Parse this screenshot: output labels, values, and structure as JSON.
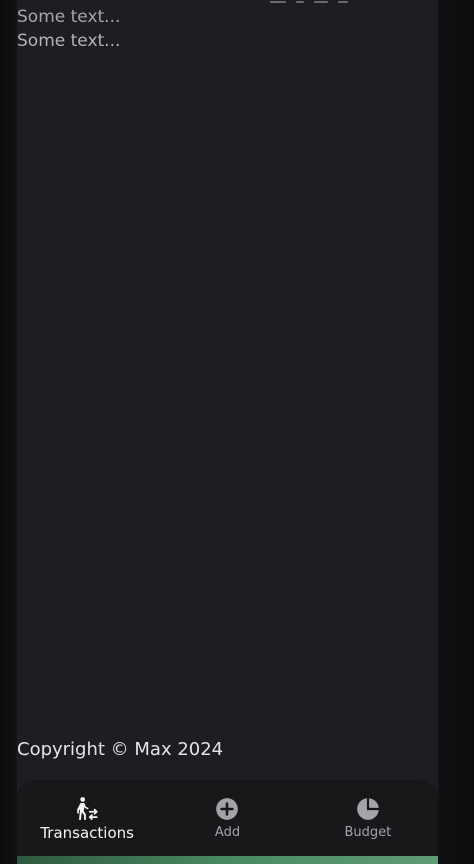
{
  "content": {
    "lines": [
      "Some text...",
      "Some text..."
    ]
  },
  "footer": {
    "copyright": "Copyright © Max 2024"
  },
  "bottom_nav": {
    "items": [
      {
        "label": "Transactions",
        "icon": "person-transactions-icon",
        "active": true
      },
      {
        "label": "Add",
        "icon": "add-circle-icon",
        "active": false
      },
      {
        "label": "Budget",
        "icon": "pie-chart-icon",
        "active": false
      }
    ]
  },
  "colors": {
    "background": "#1e1e22",
    "nav_background": "#18181b",
    "active": "#f4f4f6",
    "inactive": "#a3a3a8",
    "accent": "#4a8a63"
  }
}
